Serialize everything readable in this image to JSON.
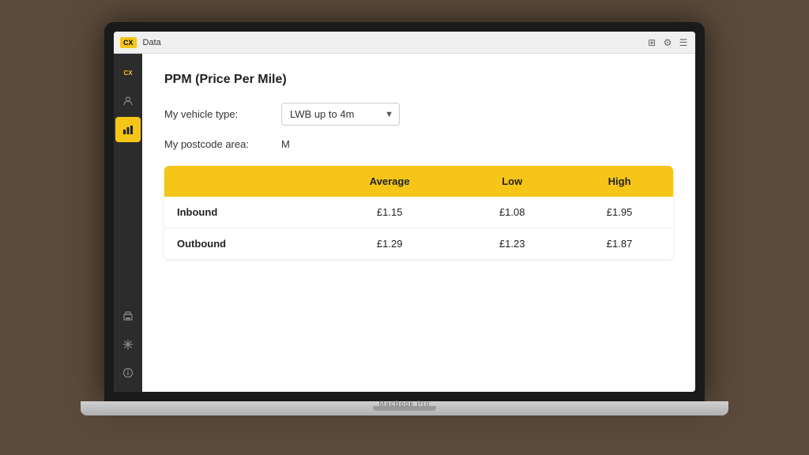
{
  "app": {
    "logo": "CX",
    "title_bar": "Data",
    "title_bar_icons": [
      "grid-icon",
      "gear-icon",
      "settings-icon"
    ]
  },
  "sidebar": {
    "items": [
      {
        "id": "cx-logo",
        "icon": "CX",
        "active": false
      },
      {
        "id": "person-icon",
        "icon": "👤",
        "active": false
      },
      {
        "id": "chart-icon",
        "icon": "📊",
        "active": true
      },
      {
        "id": "print-icon",
        "icon": "🖨",
        "active": false
      },
      {
        "id": "snowflake-icon",
        "icon": "❄",
        "active": false
      },
      {
        "id": "info-icon",
        "icon": "ℹ",
        "active": false
      }
    ]
  },
  "content": {
    "page_title": "PPM (Price Per Mile)",
    "vehicle_type_label": "My vehicle type:",
    "vehicle_type_value": "LWB up to 4m",
    "postcode_label": "My postcode area:",
    "postcode_value": "M",
    "table": {
      "headers": [
        "",
        "Average",
        "Low",
        "High"
      ],
      "rows": [
        {
          "label": "Inbound",
          "average": "£1.15",
          "low": "£1.08",
          "high": "£1.95"
        },
        {
          "label": "Outbound",
          "average": "£1.29",
          "low": "£1.23",
          "high": "£1.87"
        }
      ]
    }
  },
  "macbook_label": "MacBook Pro"
}
